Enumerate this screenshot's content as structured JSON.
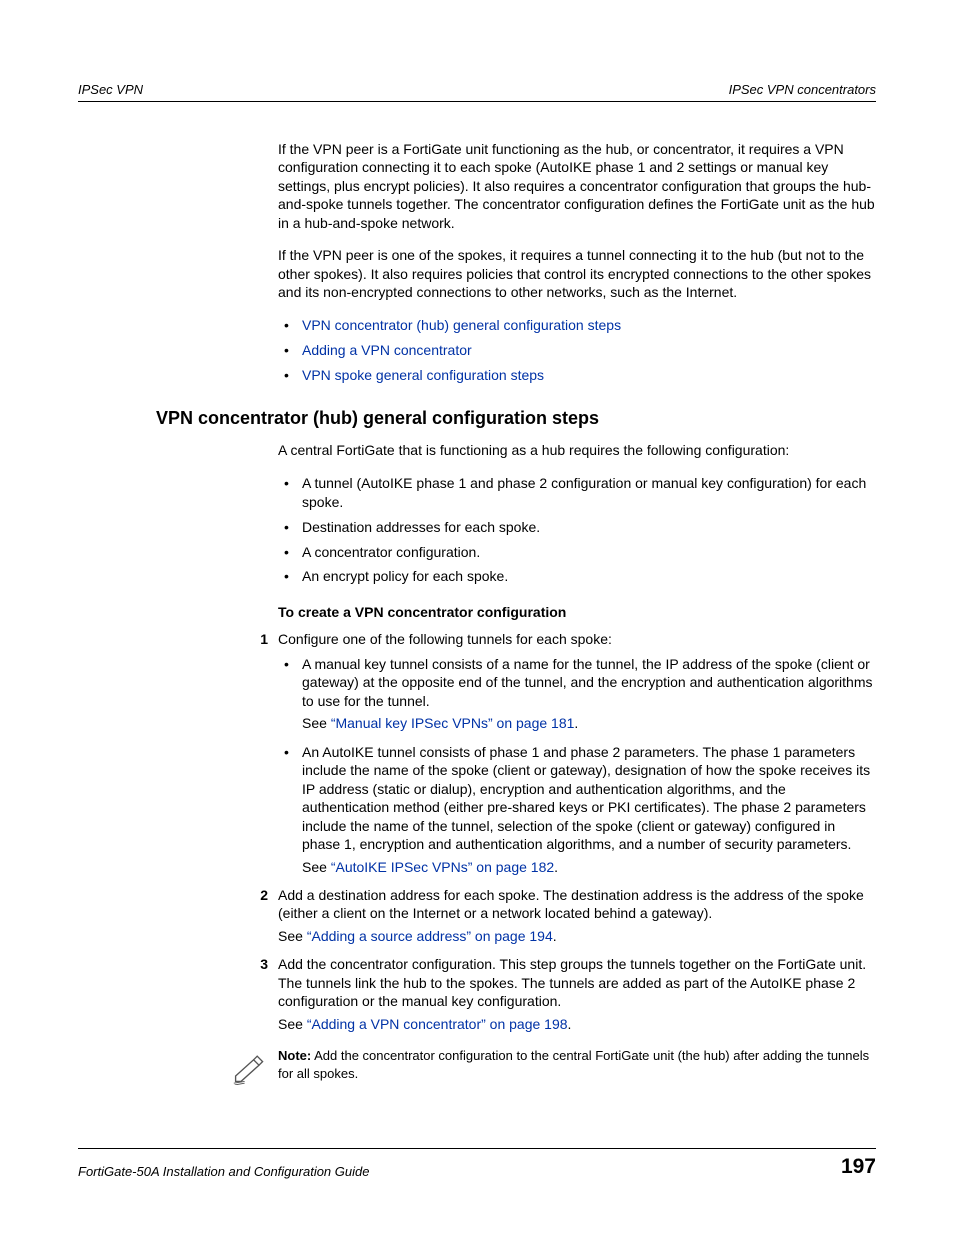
{
  "header": {
    "left": "IPSec VPN",
    "right": "IPSec VPN concentrators"
  },
  "para1": "If the VPN peer is a FortiGate unit functioning as the hub, or concentrator, it requires a VPN configuration connecting it to each spoke (AutoIKE phase 1 and 2 settings or manual key settings, plus encrypt policies). It also requires a concentrator configuration that groups the hub-and-spoke tunnels together. The concentrator configuration defines the FortiGate unit as the hub in a hub-and-spoke network.",
  "para2": "If the VPN peer is one of the spokes, it requires a tunnel connecting it to the hub (but not to the other spokes). It also requires policies that control its encrypted connections to the other spokes and its non-encrypted connections to other networks, such as the Internet.",
  "topLinks": [
    "VPN concentrator (hub) general configuration steps",
    "Adding a VPN concentrator",
    "VPN spoke general configuration steps"
  ],
  "h2": "VPN concentrator (hub) general configuration steps",
  "para3": "A central FortiGate that is functioning as a hub requires the following configuration:",
  "reqBullets": [
    "A tunnel (AutoIKE phase 1 and phase 2 configuration or manual key configuration) for each spoke.",
    "Destination addresses for each spoke.",
    "A concentrator configuration.",
    "An encrypt policy for each spoke."
  ],
  "procTitle": "To create a VPN concentrator configuration",
  "step1": {
    "num": "1",
    "lead": "Configure one of the following tunnels for each spoke:",
    "b1": "A manual key tunnel consists of a name for the tunnel, the IP address of the spoke (client or gateway) at the opposite end of the tunnel, and the encryption and authentication algorithms to use for the tunnel.",
    "b1see_pre": "See ",
    "b1see_link": "“Manual key IPSec VPNs” on page 181",
    "b1see_post": ".",
    "b2": "An AutoIKE tunnel consists of phase 1 and phase 2 parameters. The phase 1 parameters include the name of the spoke (client or gateway), designation of how the spoke receives its IP address (static or dialup), encryption and authentication algorithms, and the authentication method (either pre-shared keys or PKI certificates). The phase 2 parameters include the name of the tunnel, selection of the spoke (client or gateway) configured in phase 1, encryption and authentication algorithms, and a number of security parameters.",
    "b2see_pre": "See ",
    "b2see_link": "“AutoIKE IPSec VPNs” on page 182",
    "b2see_post": "."
  },
  "step2": {
    "num": "2",
    "body": "Add a destination address for each spoke. The destination address is the address of the spoke (either a client on the Internet or a network located behind a gateway).",
    "see_pre": "See ",
    "see_link": "“Adding a source address” on page 194",
    "see_post": "."
  },
  "step3": {
    "num": "3",
    "body": "Add the concentrator configuration. This step groups the tunnels together on the FortiGate unit. The tunnels link the hub to the spokes. The tunnels are added as part of the AutoIKE phase 2 configuration or the manual key configuration.",
    "see_pre": "See ",
    "see_link": "“Adding a VPN concentrator” on page 198",
    "see_post": "."
  },
  "note": {
    "label": "Note:",
    "body": " Add the concentrator configuration to the central FortiGate unit (the hub) after adding the tunnels for all spokes."
  },
  "footer": {
    "left": "FortiGate-50A Installation and Configuration Guide",
    "right": "197"
  }
}
